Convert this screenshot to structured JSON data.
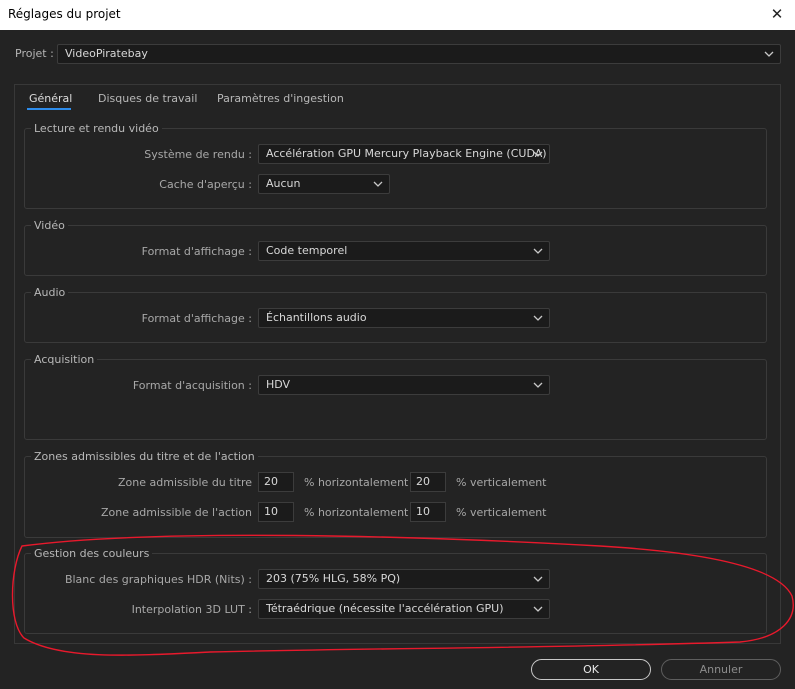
{
  "window": {
    "title": "Réglages du projet",
    "close_glyph": "✕"
  },
  "project": {
    "label": "Projet :",
    "value": "VideoPiratebay"
  },
  "tabs": [
    {
      "label": "Général",
      "active": true
    },
    {
      "label": "Disques de travail",
      "active": false
    },
    {
      "label": "Paramètres d'ingestion",
      "active": false
    }
  ],
  "groups": {
    "playback": {
      "legend": "Lecture et rendu vidéo",
      "renderer_label": "Système de rendu :",
      "renderer_value": "Accélération GPU Mercury Playback Engine (CUDA)",
      "preview_cache_label": "Cache d'aperçu :",
      "preview_cache_value": "Aucun"
    },
    "video": {
      "legend": "Vidéo",
      "display_format_label": "Format d'affichage :",
      "display_format_value": "Code temporel"
    },
    "audio": {
      "legend": "Audio",
      "display_format_label": "Format d'affichage :",
      "display_format_value": "Échantillons audio"
    },
    "capture": {
      "legend": "Acquisition",
      "capture_format_label": "Format d'acquisition :",
      "capture_format_value": "HDV"
    },
    "safe_margins": {
      "legend": "Zones admissibles du titre et de l'action",
      "title_safe_label": "Zone admissible du titre",
      "title_safe_h": "20",
      "title_safe_v": "20",
      "action_safe_label": "Zone admissible de l'action",
      "action_safe_h": "10",
      "action_safe_v": "10",
      "horizontal_unit": "% horizontalement",
      "vertical_unit": "% verticalement"
    },
    "color": {
      "legend": "Gestion des couleurs",
      "hdr_white_label": "Blanc des graphiques HDR (Nits) :",
      "hdr_white_value": "203 (75% HLG, 58% PQ)",
      "lut_label": "Interpolation 3D LUT :",
      "lut_value": "Tétraédrique (nécessite l'accélération GPU)"
    }
  },
  "buttons": {
    "ok": "OK",
    "cancel": "Annuler"
  },
  "colors": {
    "accent": "#2d8ceb",
    "annotation": "#e8192c",
    "background": "#232323"
  },
  "icons": {
    "dropdown": "chevron-down-icon",
    "close": "close-icon"
  }
}
